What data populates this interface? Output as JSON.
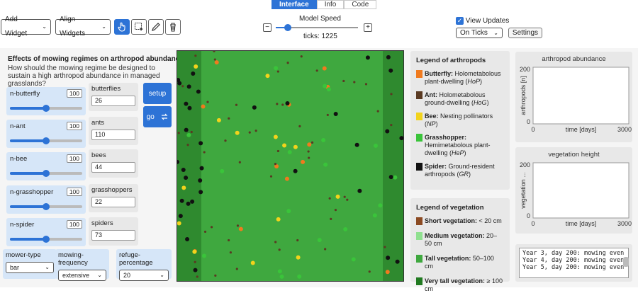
{
  "tabs": [
    {
      "label": "Interface",
      "active": true
    },
    {
      "label": "Info"
    },
    {
      "label": "Code"
    }
  ],
  "toolbar": {
    "add_widget": "Add Widget",
    "align_widgets": "Align Widgets",
    "model_speed_label": "Model Speed",
    "model_speed": 0.15,
    "minus": "−",
    "plus": "+",
    "ticks_label": "ticks: 1225",
    "view_updates_label": "View Updates",
    "view_updates_checked": true,
    "update_mode": "On Ticks",
    "settings": "Settings",
    "accent": "#2d73d6"
  },
  "header": {
    "title": "Effects of mowing regimes on arthropod abundance",
    "subtitle": "How should the mowing regime be designed to sustain a high arthropod abundance in managed grasslands?"
  },
  "sliders": [
    {
      "label": "n-butterfly",
      "value": "100",
      "fraction": 0.5
    },
    {
      "label": "n-ant",
      "value": "100",
      "fraction": 0.5
    },
    {
      "label": "n-bee",
      "value": "100",
      "fraction": 0.5
    },
    {
      "label": "n-grasshopper",
      "value": "100",
      "fraction": 0.5
    },
    {
      "label": "n-spider",
      "value": "100",
      "fraction": 0.5
    }
  ],
  "monitors": [
    {
      "label": "butterflies",
      "value": "26"
    },
    {
      "label": "ants",
      "value": "110"
    },
    {
      "label": "bees",
      "value": "44"
    },
    {
      "label": "grasshoppers",
      "value": "22"
    },
    {
      "label": "spiders",
      "value": "73"
    }
  ],
  "buttons": {
    "setup": "setup",
    "go": "go"
  },
  "choosers": [
    {
      "label": "mower-type",
      "value": "bar"
    },
    {
      "label": "mowing-frequency",
      "value": "extensive"
    },
    {
      "label": "refuge-percentage",
      "value": "20"
    }
  ],
  "legend_arthropods": {
    "title": "Legend of arthropods",
    "items": [
      {
        "name": "Butterfly:",
        "desc": "Holometabolous plant-dwelling (",
        "abbr": "HoP",
        "close": ")",
        "color": "#f07a1e"
      },
      {
        "name": "Ant:",
        "desc": "Holometabolous ground-dwelling (",
        "abbr": "HoG",
        "close": ")",
        "color": "#5a3a22"
      },
      {
        "name": "Bee:",
        "desc": "Nesting pollinators (",
        "abbr": "NP",
        "close": ")",
        "color": "#f2d31c"
      },
      {
        "name": "Grasshopper:",
        "desc": "Hemimetabolous plant-dwelling (",
        "abbr": "HeP",
        "close": ")",
        "color": "#3ac43a"
      },
      {
        "name": "Spider:",
        "desc": "Ground-resident arthropods (",
        "abbr": "GR",
        "close": ")",
        "color": "#111111"
      }
    ]
  },
  "legend_vegetation": {
    "title": "Legend of vegetation",
    "items": [
      {
        "name": "Short vegetation:",
        "desc": "< 20 cm",
        "color": "#8b4a22"
      },
      {
        "name": "Medium vegetation:",
        "desc": "20–50 cm",
        "color": "#8fe08f"
      },
      {
        "name": "Tall vegetation:",
        "desc": "50–100 cm",
        "color": "#3fa83f"
      },
      {
        "name": "Very tall vegetation:",
        "desc": "≥ 100 cm",
        "color": "#217a21"
      }
    ]
  },
  "plot1": {
    "title": "arthropod abundance",
    "ylabel": "arthropods [n]",
    "xlabel": "time [days]",
    "xmin": "0",
    "xmax": "3000",
    "ymin": "0",
    "ymax": "200"
  },
  "plot2": {
    "title": "vegetation height",
    "ylabel": "vegetation ...",
    "xlabel": "time [days]",
    "xmin": "0",
    "xmax": "3000",
    "ymin": "0",
    "ymax": "200"
  },
  "output": {
    "lines": [
      "Year 3, day 200: mowing even",
      "Year 4, day 200: mowing even",
      "Year 5, day 200: mowing even"
    ]
  }
}
